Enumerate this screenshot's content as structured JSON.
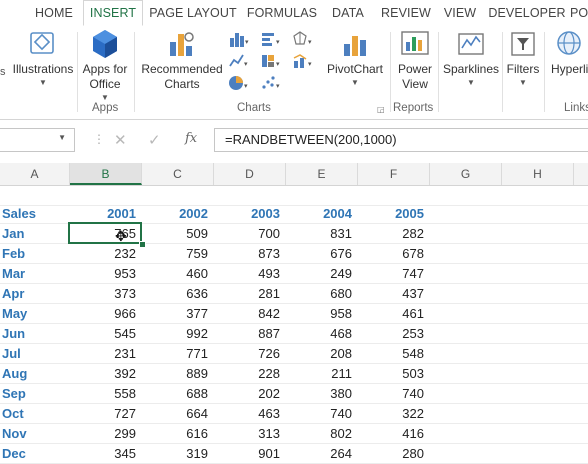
{
  "ribbon_tabs": [
    "HOME",
    "INSERT",
    "PAGE LAYOUT",
    "FORMULAS",
    "DATA",
    "REVIEW",
    "VIEW",
    "DEVELOPER",
    "PO"
  ],
  "active_tab": "INSERT",
  "ribbon": {
    "illustrations": "Illustrations",
    "apps_line1": "Apps for",
    "apps_line2": "Office",
    "apps_group": "Apps",
    "rec_line1": "Recommended",
    "rec_line2": "Charts",
    "charts_group": "Charts",
    "pivotchart": "PivotChart",
    "power_line1": "Power",
    "power_line2": "View",
    "reports_group": "Reports",
    "sparklines": "Sparklines",
    "filters": "Filters",
    "hyperlink": "Hyperlin",
    "links_group": "Links"
  },
  "formula_bar": {
    "fx_label": "fx",
    "formula": "=RANDBETWEEN(200,1000)"
  },
  "columns": [
    "A",
    "B",
    "C",
    "D",
    "E",
    "F",
    "G",
    "H"
  ],
  "table": {
    "corner": "Sales",
    "years": [
      "2001",
      "2002",
      "2003",
      "2004",
      "2005"
    ],
    "rows": [
      {
        "month": "Jan",
        "values": [
          "765",
          "509",
          "700",
          "831",
          "282"
        ]
      },
      {
        "month": "Feb",
        "values": [
          "232",
          "759",
          "873",
          "676",
          "678"
        ]
      },
      {
        "month": "Mar",
        "values": [
          "953",
          "460",
          "493",
          "249",
          "747"
        ]
      },
      {
        "month": "Apr",
        "values": [
          "373",
          "636",
          "281",
          "680",
          "437"
        ]
      },
      {
        "month": "May",
        "values": [
          "966",
          "377",
          "842",
          "958",
          "461"
        ]
      },
      {
        "month": "Jun",
        "values": [
          "545",
          "992",
          "887",
          "468",
          "253"
        ]
      },
      {
        "month": "Jul",
        "values": [
          "231",
          "771",
          "726",
          "208",
          "548"
        ]
      },
      {
        "month": "Aug",
        "values": [
          "392",
          "889",
          "228",
          "211",
          "503"
        ]
      },
      {
        "month": "Sep",
        "values": [
          "558",
          "688",
          "202",
          "380",
          "740"
        ]
      },
      {
        "month": "Oct",
        "values": [
          "727",
          "664",
          "463",
          "740",
          "322"
        ]
      },
      {
        "month": "Nov",
        "values": [
          "299",
          "616",
          "313",
          "802",
          "416"
        ]
      },
      {
        "month": "Dec",
        "values": [
          "345",
          "319",
          "901",
          "264",
          "280"
        ]
      }
    ]
  },
  "colors": {
    "accent": "#217346",
    "header_blue": "#2f75b5"
  }
}
